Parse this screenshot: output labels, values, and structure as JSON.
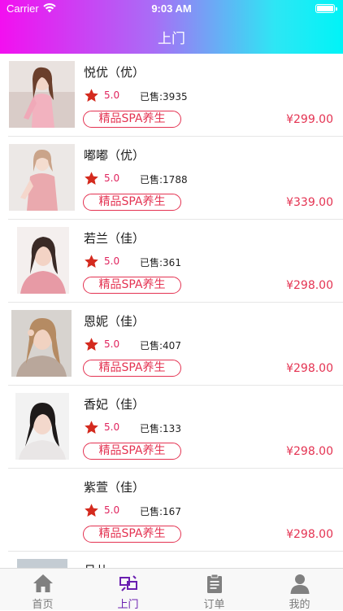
{
  "status_bar": {
    "carrier": "Carrier",
    "time": "9:03 AM"
  },
  "header": {
    "title": "上门"
  },
  "items": [
    {
      "name": "悦优（优）",
      "rating": "5.0",
      "sold": "已售:3935",
      "tag": "精品SPA养生",
      "price": "¥299.00",
      "thumb": "photo-pink-dress"
    },
    {
      "name": "嘟嘟（优）",
      "rating": "5.0",
      "sold": "已售:1788",
      "tag": "精品SPA养生",
      "price": "¥339.00",
      "thumb": "photo-pink-dress-2"
    },
    {
      "name": "若兰（佳）",
      "rating": "5.0",
      "sold": "已售:361",
      "tag": "精品SPA养生",
      "price": "¥298.00",
      "thumb": "photo-portrait-pink"
    },
    {
      "name": "恩妮（佳）",
      "rating": "5.0",
      "sold": "已售:407",
      "tag": "精品SPA养生",
      "price": "¥298.00",
      "thumb": "photo-portrait-blonde"
    },
    {
      "name": "香妃（佳）",
      "rating": "5.0",
      "sold": "已售:133",
      "tag": "精品SPA养生",
      "price": "¥298.00",
      "thumb": "photo-portrait-dark"
    },
    {
      "name": "紫萱（佳）",
      "rating": "5.0",
      "sold": "已售:167",
      "tag": "精品SPA养生",
      "price": "¥298.00",
      "thumb": "none"
    },
    {
      "name": "月儿",
      "rating": "",
      "sold": "",
      "tag": "",
      "price": "",
      "thumb": "photo-partial"
    }
  ],
  "tabbar": [
    {
      "label": "首页",
      "icon": "home-icon",
      "active": false
    },
    {
      "label": "上门",
      "icon": "door-to-door-icon",
      "active": true
    },
    {
      "label": "订单",
      "icon": "order-icon",
      "active": false
    },
    {
      "label": "我的",
      "icon": "profile-icon",
      "active": false
    }
  ],
  "colors": {
    "accent": "#e43352",
    "tab_active": "#6a1fb0",
    "star": "#d42a1e"
  }
}
